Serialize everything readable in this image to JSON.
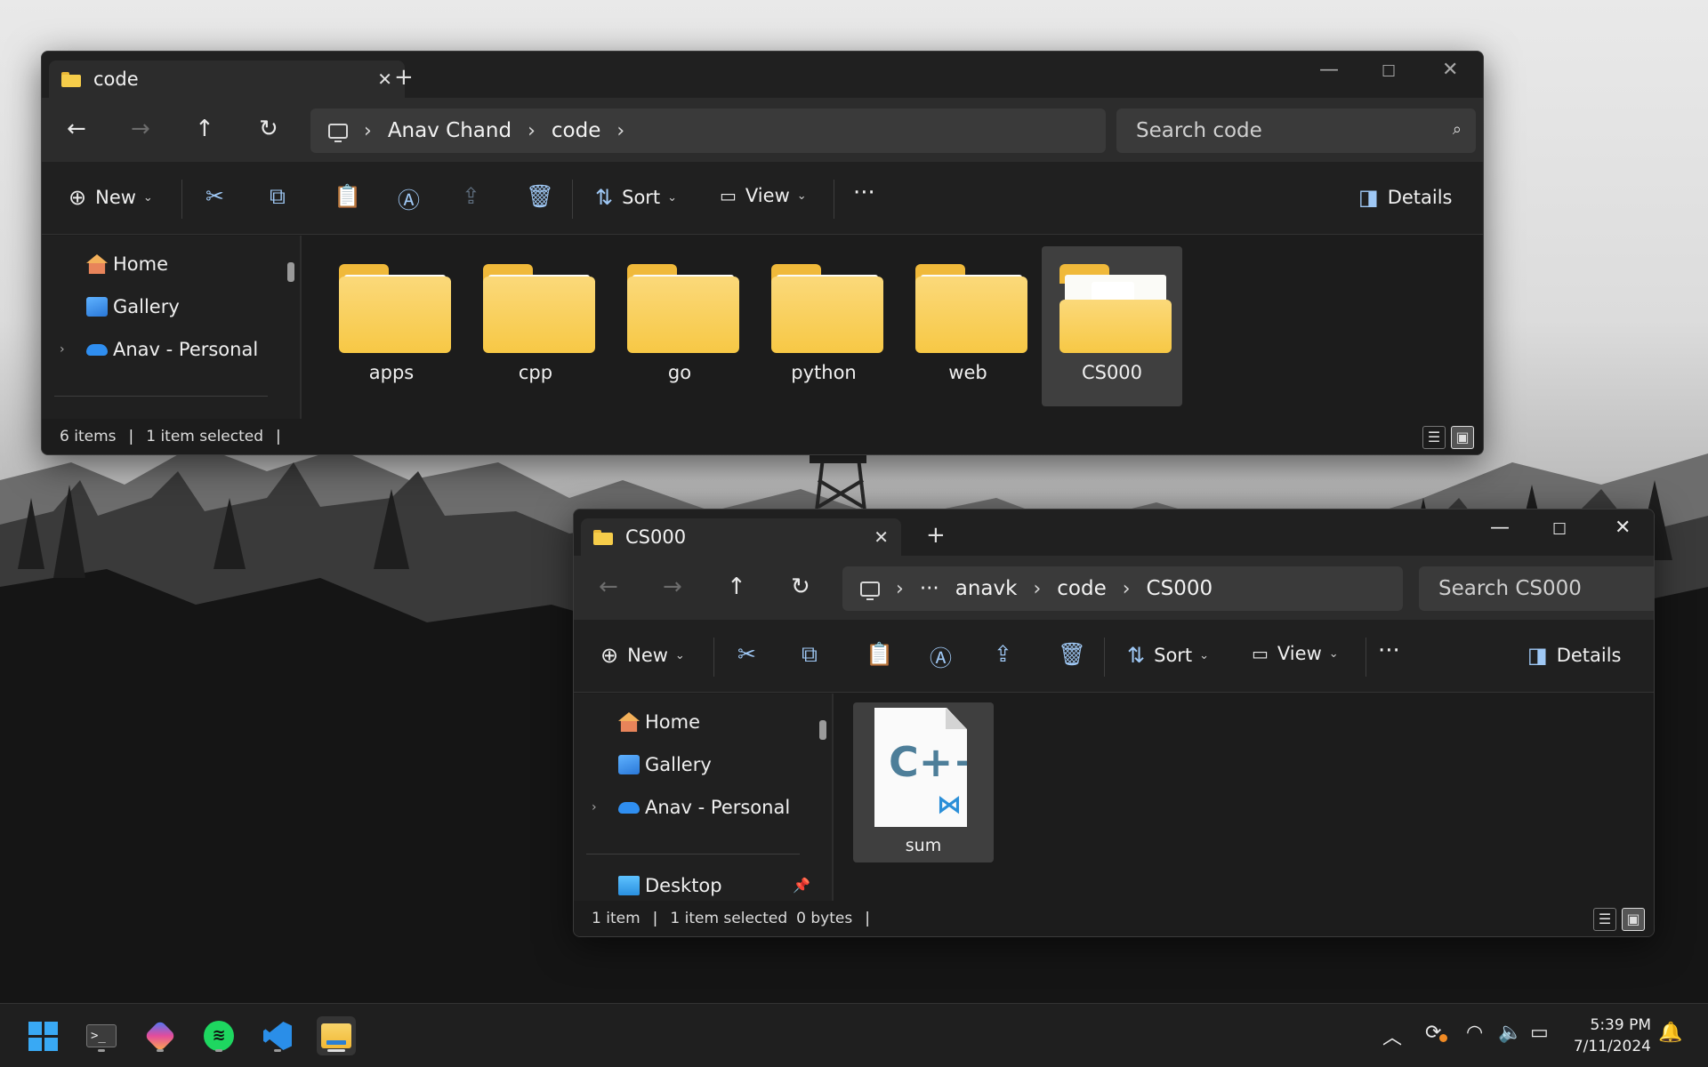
{
  "colors": {
    "window_bg": "#1c1c1c",
    "toolbar_bg": "#2c2c2c",
    "folder_yellow": "#f7c845",
    "accent_icon": "#9fc8f5"
  },
  "window_code": {
    "tab_title": "code",
    "tab_close": "✕",
    "new_tab": "+",
    "breadcrumb": [
      "Anav Chand",
      "code"
    ],
    "search_placeholder": "Search code",
    "commands": {
      "new": "New",
      "sort": "Sort",
      "view": "View",
      "more": "···",
      "details": "Details"
    },
    "sidebar": [
      {
        "label": "Home",
        "icon": "home-icon"
      },
      {
        "label": "Gallery",
        "icon": "gallery-icon"
      },
      {
        "label": "Anav - Personal",
        "icon": "onedrive-icon"
      }
    ],
    "folders": [
      {
        "name": "apps",
        "selected": false
      },
      {
        "name": "cpp",
        "selected": false
      },
      {
        "name": "go",
        "selected": false
      },
      {
        "name": "python",
        "selected": false
      },
      {
        "name": "web",
        "selected": false
      },
      {
        "name": "CS000",
        "selected": true
      }
    ],
    "status": {
      "count": "6 items",
      "selection": "1 item selected"
    }
  },
  "window_cs000": {
    "tab_title": "CS000",
    "tab_close": "✕",
    "new_tab": "+",
    "breadcrumb": [
      "···",
      "anavk",
      "code",
      "CS000"
    ],
    "search_placeholder": "Search CS000",
    "commands": {
      "new": "New",
      "sort": "Sort",
      "view": "View",
      "more": "···",
      "details": "Details"
    },
    "sidebar": [
      {
        "label": "Home",
        "icon": "home-icon"
      },
      {
        "label": "Gallery",
        "icon": "gallery-icon"
      },
      {
        "label": "Anav - Personal",
        "icon": "onedrive-icon"
      },
      {
        "label": "Desktop",
        "icon": "desktop-icon"
      }
    ],
    "files": [
      {
        "name": "sum",
        "icon": "cpp-file-icon",
        "selected": true
      }
    ],
    "status": {
      "count": "1 item",
      "selection": "1 item selected",
      "size": "0 bytes"
    }
  },
  "taskbar": {
    "apps": [
      "start-icon",
      "terminal-icon",
      "copilot-icon",
      "spotify-icon",
      "vscode-icon",
      "file-explorer-icon"
    ],
    "time": "5:39 PM",
    "date": "7/11/2024"
  }
}
